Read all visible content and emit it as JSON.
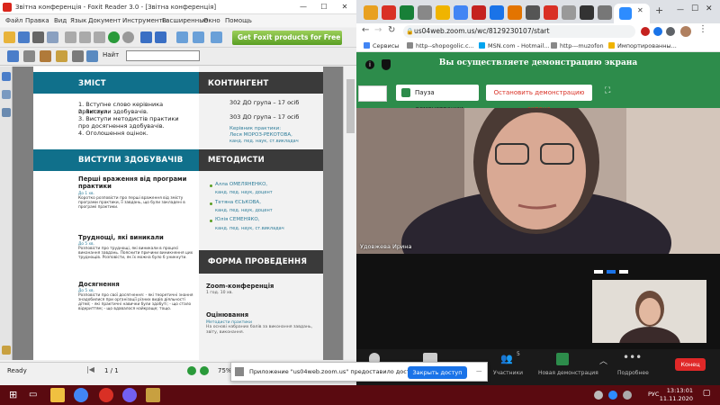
{
  "foxit": {
    "title": "Звітна конференція - Foxit Reader 3.0 - [Звітна конференція]",
    "menu": [
      "Файл",
      "Правка",
      "Вид",
      "Язык",
      "Документ",
      "Инструменты",
      "Расширенные",
      "Окно",
      "Помощь"
    ],
    "ad_text": "Get Foxit products for Free",
    "find_label": "Найт",
    "statusbar": {
      "ready": "Ready",
      "page": "1 / 1",
      "zoom": "75%"
    }
  },
  "pdf": {
    "zmist_title": "ЗМІСТ",
    "zmist_items": [
      "1. Вступне слово керівника практики.",
      "2. Виступи здобувачів.",
      "3. Виступи методистів практики про досягнення здобувачів.",
      "4. Оголошення оцінок."
    ],
    "kontingent_title": "КОНТИНГЕНТ",
    "groups": [
      "302 ДО група – 17 осіб",
      "303 ДО група – 17 осіб"
    ],
    "supervisor_label": "Керівник практики:",
    "supervisor_name": "Леся МОРОЗ-РЕКОТОВА,",
    "supervisor_title": "канд. пед. наук, ст.викладач",
    "vystupy_title": "ВИСТУПИ ЗДОБУВАЧІВ",
    "metodysty_title": "МЕТОДИСТИ",
    "talks": [
      {
        "title": "Перші враження від програми практики",
        "dur": "До 1 хв.",
        "desc": "Коротко розповісти про перші враження від змісту програми практики, її завдань, що були закладені в програмі практики."
      },
      {
        "title": "Труднощі, які виникали",
        "dur": "До 5 хв.",
        "desc": "Розповісти про труднощі, які виникали в процесі виконання завдань. Пояснити причини виникнення цих труднощів. Розповісти, як їх можна було б уникнути."
      },
      {
        "title": "Досягнення",
        "dur": "До 5 хв.",
        "desc": "Розповісти про свої досягнення: - які теоретичні знання знадобилися при організації різних видів діяльності дітей; - які практичні навички були здобуті; - що стало відкриттям; - що вдавалося найкраще; тощо."
      }
    ],
    "methodists": [
      {
        "name": "Алла ОМЕЛЯНЕНКО,",
        "title": "канд. пед. наук, доцент"
      },
      {
        "name": "Тетяна ЄСЬКОВА,",
        "title": "канд. пед. наук, доцент"
      },
      {
        "name": "Юлія СЕМЕНЯКО,",
        "title": "канд. пед. наук, ст.викладач"
      }
    ],
    "forma_title": "ФОРМА ПРОВЕДЕННЯ",
    "zoom_label": "Zoom-конференція",
    "zoom_dur": "1 год. 10 хв.",
    "ocin_label": "Оцінювання",
    "ocin_sub": "Методисти практики",
    "ocin_desc": "На основі набраних балів за виконання завдань, звіту, виконання."
  },
  "chrome": {
    "url": "us04web.zoom.us/wc/8129230107/start",
    "bookmarks": [
      "Сервисы",
      "http--shopogolic.c...",
      "MSN.com - Hotmail...",
      "http---muzofon",
      "Импортированны..."
    ]
  },
  "zoom": {
    "share_status": "Вы осуществляете демонстрацию экрана",
    "pause_label": "Пауза демонстрации",
    "stop_label": "Остановить демонстрацию экрана",
    "speaker_name": "Удовжева Ирина",
    "toolbar": {
      "participants_label": "Участники",
      "participants_count": "5",
      "share_label": "Новая демонстрация",
      "more_label": "Подробнее",
      "end_label": "Конец"
    },
    "notification": {
      "text": "Приложение \"us04web.zoom.us\" предоставило доступ к окну.",
      "button": "Закрыть доступ"
    }
  },
  "taskbar": {
    "lang": "РУС",
    "time": "13:13:01",
    "date": "11.11.2020"
  },
  "colors": {
    "zoom_green": "#2d8c4b",
    "pdf_teal": "#10708b",
    "taskbar": "#5a0a10",
    "end_red": "#e02828"
  }
}
